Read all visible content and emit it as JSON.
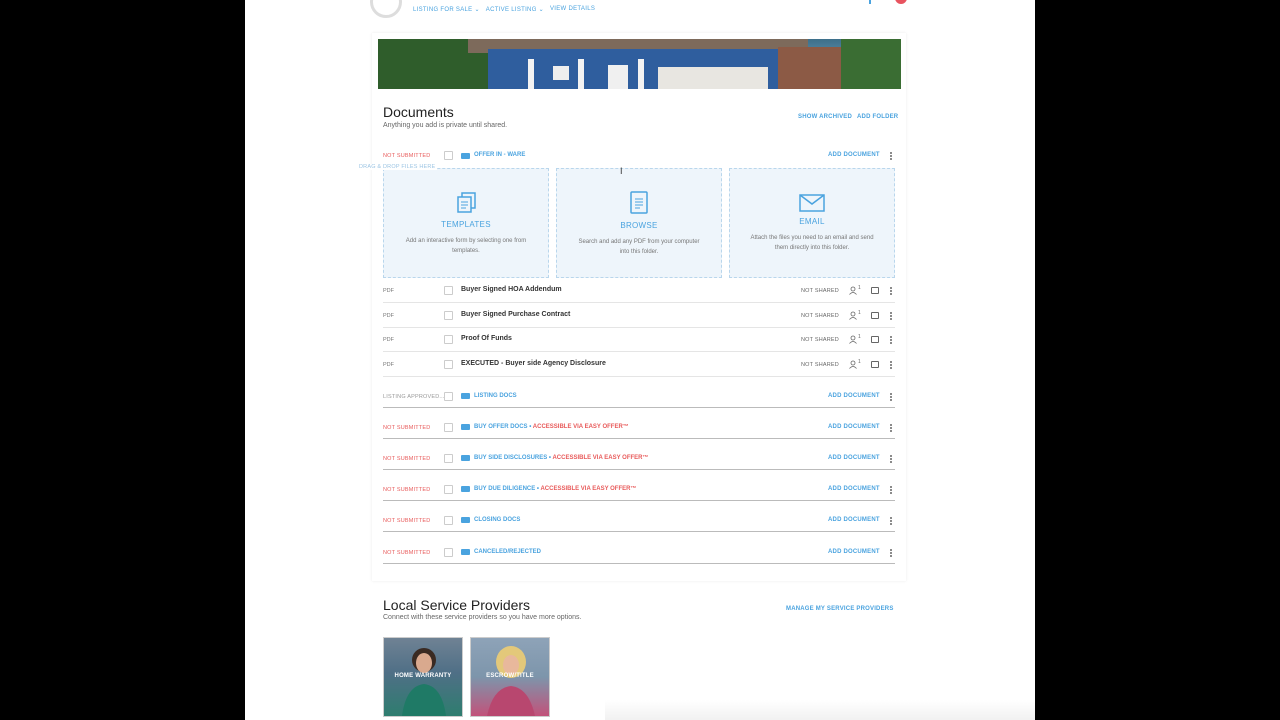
{
  "topnav": {
    "items": [
      "LISTING FOR SALE",
      "ACTIVE LISTING",
      "VIEW DETAILS"
    ]
  },
  "documents": {
    "title": "Documents",
    "subtitle": "Anything you add is private until shared.",
    "show_archived": "SHOW ARCHIVED",
    "add_folder": "ADD FOLDER",
    "add_document": "ADD DOCUMENT",
    "drag_text": "DRAG & DROP FILES HERE",
    "offer_folder": {
      "status": "NOT SUBMITTED",
      "name": "OFFER IN - WARE"
    },
    "dropzones": [
      {
        "title": "TEMPLATES",
        "desc": "Add an interactive form by selecting one from templates."
      },
      {
        "title": "BROWSE",
        "desc": "Search and add any PDF from your computer into this folder."
      },
      {
        "title": "EMAIL",
        "desc": "Attach the files you need to an email and send them directly into this folder."
      }
    ],
    "files": [
      {
        "type": "PDF",
        "name": "Buyer Signed HOA Addendum",
        "shared": "NOT SHARED"
      },
      {
        "type": "PDF",
        "name": "Buyer Signed Purchase Contract",
        "shared": "NOT SHARED"
      },
      {
        "type": "PDF",
        "name": "Proof Of Funds",
        "shared": "NOT SHARED"
      },
      {
        "type": "PDF",
        "name": "EXECUTED - Buyer side Agency Disclosure",
        "shared": "NOT SHARED"
      }
    ],
    "folders": [
      {
        "status": "LISTING APPROVED...",
        "name": "LISTING DOCS",
        "accessible": ""
      },
      {
        "status": "NOT SUBMITTED",
        "name": "BUY OFFER DOCS",
        "accessible": "ACCESSIBLE VIA EASY OFFER™"
      },
      {
        "status": "NOT SUBMITTED",
        "name": "BUY SIDE DISCLOSURES",
        "accessible": "ACCESSIBLE VIA EASY OFFER™"
      },
      {
        "status": "NOT SUBMITTED",
        "name": "BUY DUE DILIGENCE",
        "accessible": "ACCESSIBLE VIA EASY OFFER™"
      },
      {
        "status": "NOT SUBMITTED",
        "name": "CLOSING DOCS",
        "accessible": ""
      },
      {
        "status": "NOT SUBMITTED",
        "name": "CANCELED/REJECTED",
        "accessible": ""
      }
    ],
    "user_count": "1"
  },
  "providers": {
    "title": "Local Service Providers",
    "subtitle": "Connect with these service providers so you have more options.",
    "manage": "MANAGE MY SERVICE PROVIDERS",
    "cards": [
      {
        "label": "HOME WARRANTY"
      },
      {
        "label": "ESCROW/TITLE"
      }
    ]
  },
  "colors": {
    "accent": "#4aa3df",
    "alert": "#e85a5a"
  }
}
